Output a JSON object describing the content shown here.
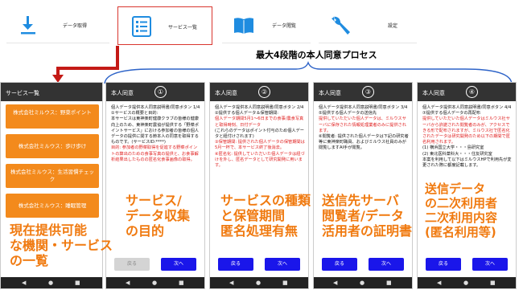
{
  "nav": [
    {
      "label": "データ取得",
      "icon": "download-icon",
      "active": false
    },
    {
      "label": "サービス一覧",
      "icon": "list-icon",
      "active": true
    },
    {
      "label": "データ閲覧",
      "icon": "book-icon",
      "active": false
    },
    {
      "label": "設定",
      "icon": "wrench-icon",
      "active": false
    }
  ],
  "process_title": "最大4段階の本人同意プロセス",
  "list_screen": {
    "header": "サービス一覧",
    "items": [
      "株式会社ミルウス：野菜ポイント",
      "株式会社ミルウス：歩け歩け",
      "株式会社ミルウス：生活習慣チェック",
      "株式会社ミルウス：睡眠管理"
    ]
  },
  "screens": [
    {
      "header": "本人同意",
      "step": "①",
      "doc_title": "個人データ提供本人同意説明書/同意ボタン 1/4",
      "body": [
        "①サービスの概要と目的:",
        "本サービスは東神楽町健康クラブの皆様の健康向上のため、東神楽町農協が提供する「野菜ポイントサービス」における参加者の皆様の個人データの提供に関する節本人の同意を取得するものです。(サービスID:****)",
        "目的: 参加者の野菜取得を促進する野菜ポイントの算出のための食事写真の提供と、お食事解析結果出したものの匿名化食事画像の取得。"
      ],
      "back": "戻る",
      "back_disabled": true,
      "next": "次へ"
    },
    {
      "header": "本人同意",
      "step": "②",
      "doc_title": "個人データ提供本人同意説明書/同意ボタン 2/4",
      "body": [
        "②提供する個人データ＆保管期間:",
        "個人データ期間5月1〜6日までの食事/農食写真と取得時刻、日付データ",
        "(これらのデータはポイント付与のため個人データと紐付けされます)",
        "③保管期間: 提供された個人データの保管期間は5月一杯で、本サービス終了後消去。",
        "④匿名化: 提供していただいた個人データは紐づけを外し、匿名データとして研究開発に用います。"
      ],
      "back": "戻る",
      "back_disabled": false,
      "next": "次へ"
    },
    {
      "header": "本人同意",
      "step": "③",
      "doc_title": "個人データ提供本人同意説明書/同意ボタン 3/4",
      "body": [
        "⑤提供する個人データの送信先",
        "提供していただいた個人データは、ミルウスサーバに保存された情報処理業者のみに提供されます。",
        "⑥閲覧者: 提供された個人データは下記の研究者等に東神楽町職員、およびミルウス社員のみが閲覧しますAI手が閲覧。"
      ],
      "back": "戻る",
      "back_disabled": false,
      "next": "次へ"
    },
    {
      "header": "本人同意",
      "step": "④",
      "doc_title": "個人データ提供本人同意説明書/同意ボタン 4/4",
      "body": [
        "⑦提供する個人データの再配布",
        "提供していただいた個人データはミルウス社サーバから許諾された閲覧者のみが、アクセスできる形で配布されますが、ミルウス社で匿名化されたデータは研究開発のため以下の期間で匿名利用されます。",
        "(1) 横浜国立大学・・・島研究室",
        "(2) 東北医科薬科大・・・住友研究室",
        "本案を利用して以下はミルウスHPで利用先が変更された際に都度記載します。"
      ],
      "back": "戻る",
      "back_disabled": false,
      "next": "次へ"
    }
  ],
  "captions": [
    {
      "text": [
        "現在提供可能",
        "な機関・サービス",
        "の一覧"
      ],
      "style": "orange"
    },
    {
      "text": [
        "サービス/",
        "データ収集",
        "の目的"
      ],
      "style": "white"
    },
    {
      "text": [
        "サービスの種類",
        "と保管期間",
        "匿名処理有無"
      ],
      "style": "white"
    },
    {
      "text": [
        "送信先サーバ",
        "閲覧者/データ",
        "活用者の証明書"
      ],
      "style": "white"
    },
    {
      "text": [
        "送信データ",
        "の二次利用者",
        "二次利用内容",
        "(匿名利用等)"
      ],
      "style": "white"
    }
  ],
  "colors": {
    "accent_orange": "#f38a1c",
    "button_blue": "#1a16ea",
    "highlight_red": "#d9362f",
    "header_dark": "#333333"
  }
}
